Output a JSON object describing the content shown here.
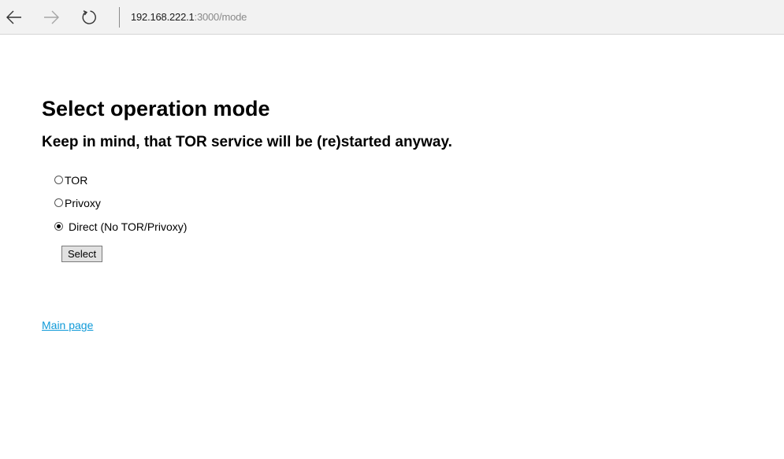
{
  "browser": {
    "url_host": "192.168.222.1",
    "url_path": ":3000/mode",
    "icons": {
      "back": "back-arrow-icon",
      "forward": "forward-arrow-icon",
      "refresh": "refresh-icon"
    }
  },
  "page": {
    "title": "Select operation mode",
    "subtitle": "Keep in mind, that TOR service will be (re)started anyway.",
    "options": [
      {
        "label": "TOR",
        "checked": false
      },
      {
        "label": "Privoxy",
        "checked": false
      },
      {
        "label": "Direct (No TOR/Privoxy)",
        "checked": true
      }
    ],
    "submit_label": "Select",
    "main_link_label": "Main page",
    "link_color": "#0f9ad8"
  }
}
